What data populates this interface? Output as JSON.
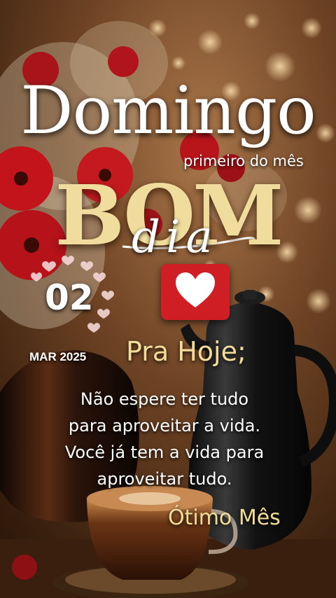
{
  "card": {
    "title": "Domingo",
    "subtitle": "primeiro do mês",
    "greeting_main": "BOM",
    "greeting_script": "dia",
    "day": "02",
    "month_year": "MAR 2025",
    "heading": "Pra Hoje;",
    "message_lines": [
      "Não espere ter tudo",
      "para aproveitar a vida.",
      "Você já tem a vida para",
      "aproveitar tudo."
    ],
    "closing": "Ótimo Mês"
  },
  "icons": {
    "reaction": "heart-icon",
    "decor": "small-hearts-icon"
  },
  "colors": {
    "gold_text": "#f1dc9a",
    "white_text": "#ffffff",
    "flower_red": "#c3141b",
    "heart_badge": "#cf1e24",
    "background_warm": "#6e4324"
  }
}
